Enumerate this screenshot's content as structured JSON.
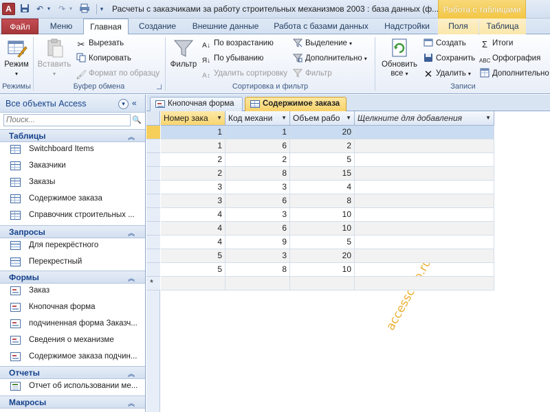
{
  "window": {
    "app_icon_letter": "A",
    "title": "Расчеты с заказчиками за работу строительных механизмов 2003 : база данных (ф...",
    "context_title": "Работа с таблицами"
  },
  "ribbon_tabs": [
    {
      "label": "Файл"
    },
    {
      "label": "Меню"
    },
    {
      "label": "Главная"
    },
    {
      "label": "Создание"
    },
    {
      "label": "Внешние данные"
    },
    {
      "label": "Работа с базами данных"
    },
    {
      "label": "Надстройки"
    },
    {
      "label": "Поля"
    },
    {
      "label": "Таблица"
    }
  ],
  "ribbon": {
    "modes": {
      "view_label": "Режим",
      "group_label": "Режимы"
    },
    "clipboard": {
      "paste_label": "Вставить",
      "cut_label": "Вырезать",
      "copy_label": "Копировать",
      "format_painter_label": "Формат по образцу",
      "group_label": "Буфер обмена"
    },
    "sort_filter": {
      "filter_label": "Фильтр",
      "ascending_label": "По возрастанию",
      "descending_label": "По убыванию",
      "remove_sort_label": "Удалить сортировку",
      "selection_label": "Выделение",
      "advanced_label": "Дополнительно",
      "toggle_filter_label": "Фильтр",
      "group_label": "Сортировка и фильтр"
    },
    "records": {
      "refresh_label_1": "Обновить",
      "refresh_label_2": "все",
      "new_label": "Создать",
      "save_label": "Сохранить",
      "delete_label": "Удалить",
      "totals_label": "Итоги",
      "spelling_label": "Орфография",
      "more_label": "Дополнительно",
      "group_label": "Записи"
    }
  },
  "nav": {
    "title": "Все объекты Access",
    "search_placeholder": "Поиск...",
    "groups": [
      {
        "title": "Таблицы",
        "items": [
          "Switchboard Items",
          "Заказчики",
          "Заказы",
          "Содержимое заказа",
          "Справочник строительных ..."
        ]
      },
      {
        "title": "Запросы",
        "items": [
          "Для перекрёстного",
          "Перекрестный"
        ]
      },
      {
        "title": "Формы",
        "items": [
          "Заказ",
          "Кнопочная форма",
          "подчиненная форма Заказч...",
          "Сведения о механизме",
          "Содержимое заказа подчин..."
        ]
      },
      {
        "title": "Отчеты",
        "items": [
          "Отчет об использовании ме..."
        ]
      },
      {
        "title": "Макросы",
        "items": []
      }
    ]
  },
  "doc_tabs": [
    {
      "label": "Кнопочная форма"
    },
    {
      "label": "Содержимое заказа"
    }
  ],
  "datasheet": {
    "columns": [
      "Номер зака",
      "Код механи",
      "Объем рабо",
      "Щелкните для добавления"
    ],
    "rows": [
      [
        "1",
        "1",
        "20"
      ],
      [
        "1",
        "6",
        "2"
      ],
      [
        "2",
        "2",
        "5"
      ],
      [
        "2",
        "8",
        "15"
      ],
      [
        "3",
        "3",
        "4"
      ],
      [
        "3",
        "6",
        "8"
      ],
      [
        "4",
        "3",
        "10"
      ],
      [
        "4",
        "6",
        "10"
      ],
      [
        "4",
        "9",
        "5"
      ],
      [
        "5",
        "3",
        "20"
      ],
      [
        "5",
        "8",
        "10"
      ]
    ],
    "new_row_marker": "*"
  },
  "watermark": "accessclub.ru",
  "colors": {
    "file_tab": "#a4373a",
    "context_tab": "#f3c745",
    "active_doc_tab": "#f8d26a",
    "selected_row": "#c9dcf1",
    "current_record_marker": "#f6cf5b"
  },
  "icons": [
    "save-icon",
    "undo-icon",
    "redo-icon",
    "view-icon",
    "paste-icon",
    "cut-icon",
    "copy-icon",
    "format-painter-icon",
    "filter-icon",
    "sort-ascending-icon",
    "sort-descending-icon",
    "remove-sort-icon",
    "selection-icon",
    "advanced-filter-icon",
    "toggle-filter-icon",
    "refresh-icon",
    "new-record-icon",
    "save-record-icon",
    "delete-icon",
    "totals-icon",
    "spelling-icon",
    "more-icon",
    "table-icon",
    "query-icon",
    "form-icon",
    "report-icon"
  ]
}
